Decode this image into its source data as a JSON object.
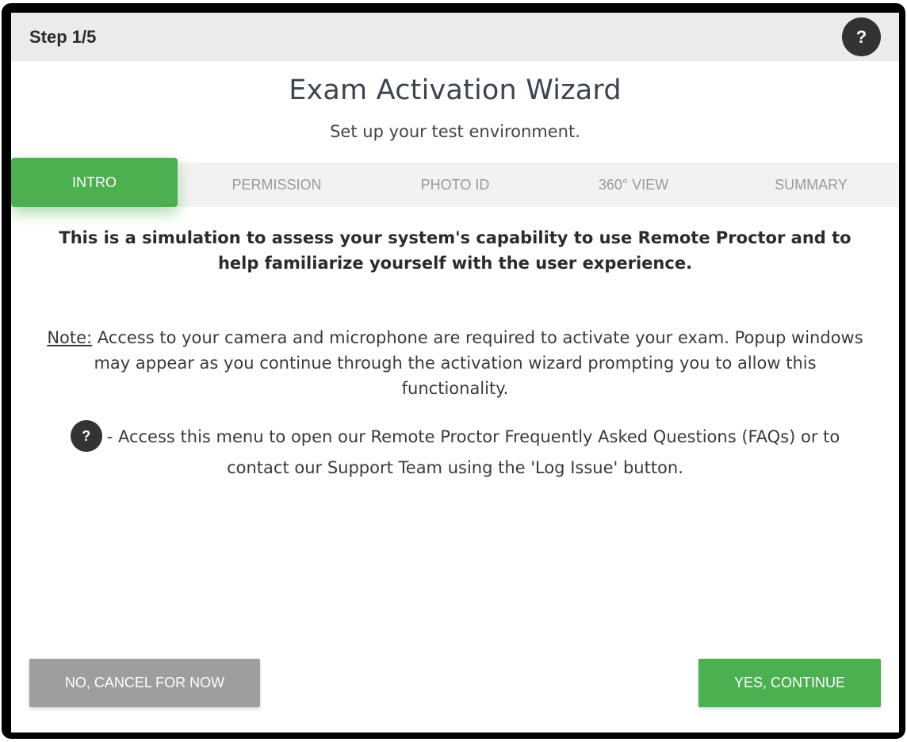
{
  "header": {
    "step": "Step 1/5",
    "help_icon": "?"
  },
  "wizard": {
    "title": "Exam Activation Wizard",
    "subtitle": "Set up your test environment."
  },
  "tabs": [
    {
      "label": "INTRO",
      "active": true
    },
    {
      "label": "PERMISSION",
      "active": false
    },
    {
      "label": "PHOTO ID",
      "active": false
    },
    {
      "label": "360° VIEW",
      "active": false
    },
    {
      "label": "SUMMARY",
      "active": false
    }
  ],
  "content": {
    "intro": "This is a simulation to assess your system's capability to use Remote Proctor and to help familiarize yourself with the user experience.",
    "note_label": "Note:",
    "note_text": " Access to your camera and microphone are required to activate your exam. Popup windows may appear as you continue through the activation wizard prompting you to allow this functionality.",
    "faq_icon": "?",
    "faq_text": "- Access this menu to open our Remote Proctor Frequently Asked Questions (FAQs) or to contact our Support Team using the 'Log Issue' button."
  },
  "footer": {
    "cancel_label": "NO, CANCEL FOR NOW",
    "continue_label": "YES, CONTINUE"
  },
  "colors": {
    "accent": "#4caf50",
    "secondary_button": "#9e9e9e",
    "header_bg": "#ebebeb",
    "help_icon_bg": "#333333"
  }
}
